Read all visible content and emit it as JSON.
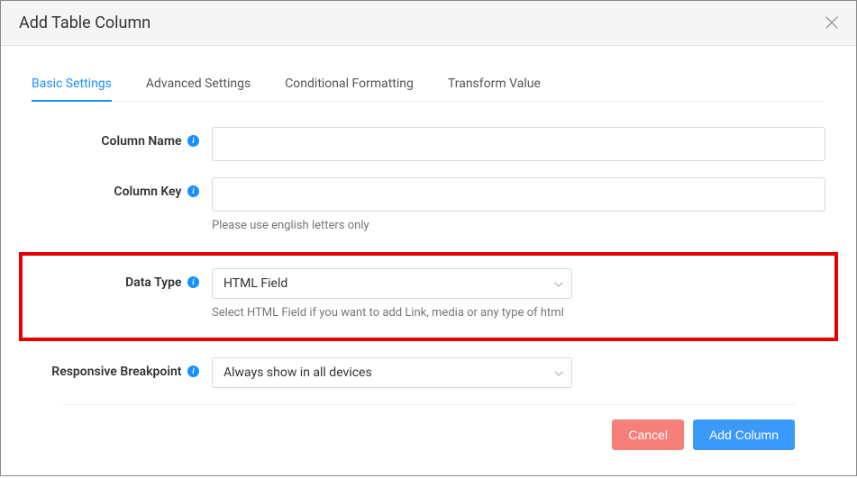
{
  "header": {
    "title": "Add Table Column"
  },
  "tabs": {
    "basic": "Basic Settings",
    "advanced": "Advanced Settings",
    "conditional": "Conditional Formatting",
    "transform": "Transform Value"
  },
  "form": {
    "column_name": {
      "label": "Column Name",
      "value": ""
    },
    "column_key": {
      "label": "Column Key",
      "value": "",
      "help": "Please use english letters only"
    },
    "data_type": {
      "label": "Data Type",
      "value": "HTML Field",
      "help": "Select HTML Field if you want to add Link, media or any type of html"
    },
    "breakpoint": {
      "label": "Responsive Breakpoint",
      "value": "Always show in all devices"
    }
  },
  "footer": {
    "cancel": "Cancel",
    "submit": "Add Column"
  }
}
